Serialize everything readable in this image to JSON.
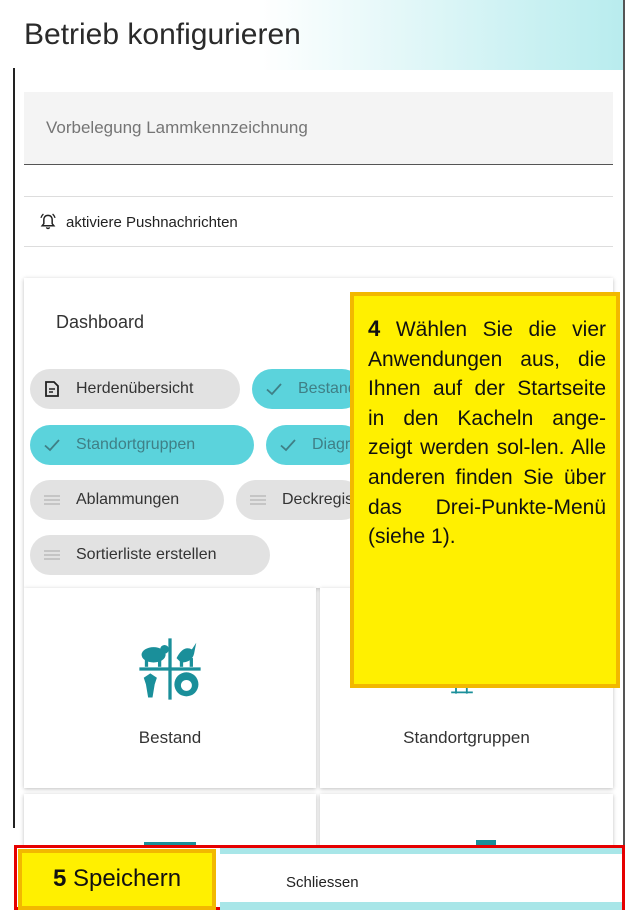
{
  "dialog": {
    "title": "Betrieb konfigurieren",
    "lamb_field_placeholder": "Vorbelegung Lammkennzeichnung",
    "push_label": "aktiviere Pushnachrichten"
  },
  "dashboard": {
    "title": "Dashboard",
    "chips": [
      {
        "label": "Herdenübersicht",
        "selected": false,
        "icon": "document-icon"
      },
      {
        "label": "Bestand",
        "selected": true,
        "icon": "check-icon"
      },
      {
        "label": "Standortgruppen",
        "selected": true,
        "icon": "check-icon"
      },
      {
        "label": "Diagramme",
        "selected": true,
        "icon": "check-icon"
      },
      {
        "label": "Ablammungen",
        "selected": false,
        "icon": "list-icon"
      },
      {
        "label": "Deckregister",
        "selected": false,
        "icon": "list-icon"
      },
      {
        "label": "Sortierliste erstellen",
        "selected": false,
        "icon": "list-icon"
      }
    ],
    "tiles": [
      {
        "label": "Bestand",
        "icon": "livestock-icon"
      },
      {
        "label": "Standortgruppen",
        "icon": "location-groups-icon"
      },
      {
        "label": "",
        "icon": "tile-icon"
      },
      {
        "label": "",
        "icon": "tile-icon"
      }
    ]
  },
  "annotations": {
    "step4_number": "4",
    "step4_text": "Wählen Sie die vier Anwendungen aus, die Ihnen auf der Startseite in den Kacheln ange-zeigt werden sol-len. Alle anderen finden Sie über das Drei-Punkte-Menü (siehe 1).",
    "step5_number": "5",
    "step5_text": "Speichern"
  },
  "footer": {
    "close_label": "Schliessen"
  },
  "colors": {
    "accent": "#5bd3dc",
    "chip_off": "#e2e2e2",
    "annotation_fill": "#fff000",
    "annotation_border": "#f2b800",
    "highlight_frame": "#e60000",
    "icon_teal": "#1a8f9a"
  }
}
